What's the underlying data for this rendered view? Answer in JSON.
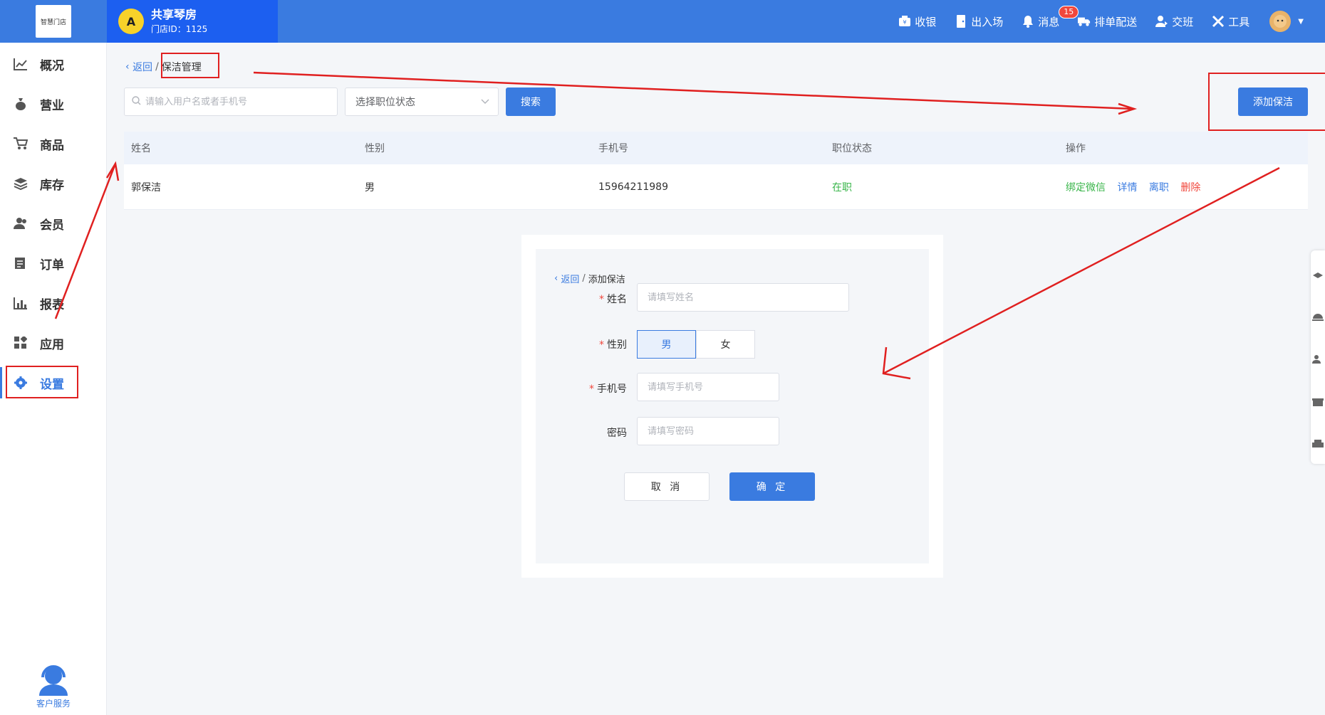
{
  "header": {
    "logo_text": "智慧门店",
    "store_name": "共享琴房",
    "store_id": "门店ID：1125",
    "menu": [
      "收银",
      "出入场",
      "消息",
      "排单配送",
      "交班",
      "工具"
    ],
    "msg_count": "15"
  },
  "sidebar": {
    "items": [
      "概况",
      "营业",
      "商品",
      "库存",
      "会员",
      "订单",
      "报表",
      "应用",
      "设置"
    ],
    "active": "设置",
    "customer_service": "客户服务"
  },
  "breadcrumb": {
    "back": "返回",
    "separator": "/",
    "current": "保洁管理"
  },
  "filters": {
    "search_placeholder": "请输入用户名或者手机号",
    "status_placeholder": "选择职位状态",
    "search_label": "搜索",
    "add_label": "添加保洁"
  },
  "table": {
    "headers": [
      "姓名",
      "性别",
      "手机号",
      "职位状态",
      "操作"
    ],
    "rows": [
      {
        "name": "郭保洁",
        "gender": "男",
        "phone": "15964211989",
        "status": "在职"
      }
    ],
    "actions": [
      "绑定微信",
      "详情",
      "离职",
      "删除"
    ]
  },
  "dialog": {
    "back": "返回",
    "separator": "/",
    "title": "添加保洁",
    "fields": {
      "name_label": "姓名",
      "name_placeholder": "请填写姓名",
      "gender_label": "性别",
      "gender_options": [
        "男",
        "女"
      ],
      "gender_selected": "男",
      "phone_label": "手机号",
      "phone_placeholder": "请填写手机号",
      "password_label": "密码",
      "password_placeholder": "请填写密码"
    },
    "cancel_label": "取 消",
    "ok_label": "确 定"
  },
  "colors": {
    "primary": "#3a7be0",
    "annotation": "#e02020",
    "success": "#39b54a",
    "danger": "#f0473c"
  }
}
